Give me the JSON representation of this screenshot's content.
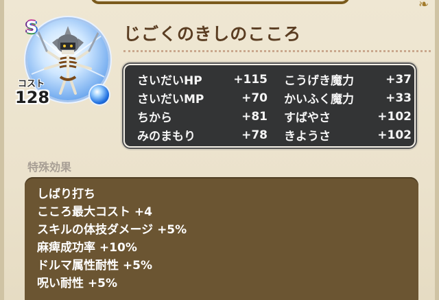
{
  "monster": {
    "name": "じごくのきしのこころ",
    "rank": "S",
    "cost_label": "コスト",
    "cost_value": "128"
  },
  "stats": [
    {
      "label": "さいだいHP",
      "value": "+115"
    },
    {
      "label": "こうげき魔力",
      "value": "+37"
    },
    {
      "label": "さいだいMP",
      "value": "+70"
    },
    {
      "label": "かいふく魔力",
      "value": "+33"
    },
    {
      "label": "ちから",
      "value": "+81"
    },
    {
      "label": "すばやさ",
      "value": "+102"
    },
    {
      "label": "みのまもり",
      "value": "+78"
    },
    {
      "label": "きようさ",
      "value": "+102"
    }
  ],
  "special": {
    "section_label": "特殊効果",
    "effects": [
      "しばり打ち",
      "こころ最大コスト +4",
      "スキルの体技ダメージ +5%",
      "麻痺成功率 +10%",
      "ドルマ属性耐性 +5%",
      "呪い耐性 +5%"
    ]
  },
  "colors": {
    "name_text": "#5a3d22",
    "stats_bg": "#333435",
    "effects_bg": "#6b5532",
    "orb": "#1f6fe0"
  },
  "icons": {
    "rank": "rank-s-badge",
    "orb": "blue-orb-icon",
    "portrait": "skeleton-knight-portrait"
  }
}
